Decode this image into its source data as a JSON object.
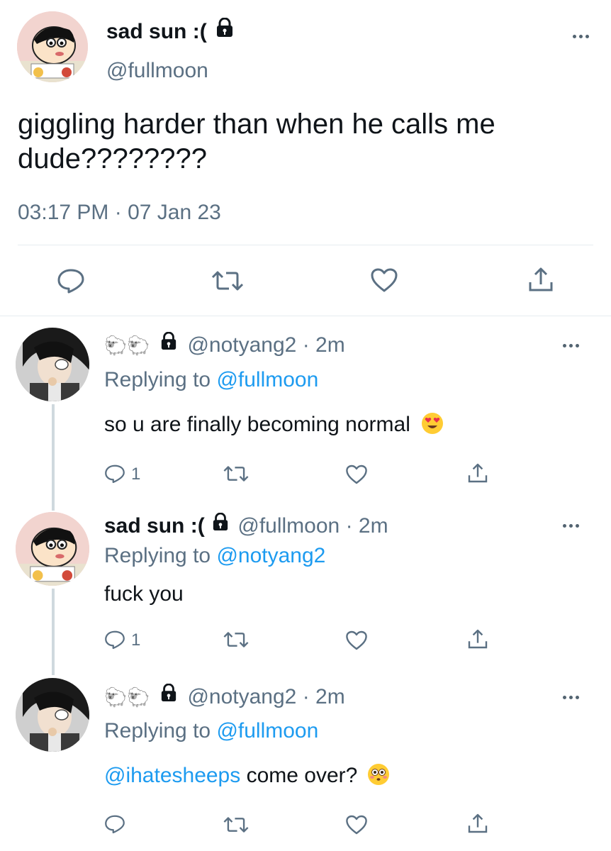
{
  "main_tweet": {
    "display_name": "sad sun :(",
    "handle": "@fullmoon",
    "text_line1": "giggling harder than when he calls me",
    "text_line2": "dude????????",
    "timestamp": "03:17 PM · 07 Jan 23"
  },
  "replies": [
    {
      "name_icons": "sheep-sheep-lock",
      "handle": "@notyang2",
      "time": "· 2m",
      "replying_label": "Replying to",
      "replying_to": "@fullmoon",
      "text": "so u are finally becoming normal",
      "emoji": "heart-eyes",
      "reply_count": "1"
    },
    {
      "display_name": "sad sun :(",
      "handle": "@fullmoon",
      "time": "· 2m",
      "replying_label": "Replying to",
      "replying_to": "@notyang2",
      "text": "fuck you",
      "reply_count": "1"
    },
    {
      "name_icons": "sheep-sheep-lock",
      "handle": "@notyang2",
      "time": "· 2m",
      "replying_label": "Replying to",
      "replying_to": "@fullmoon",
      "mention": "@ihatesheeps",
      "text": " come over?",
      "emoji": "flushed"
    }
  ],
  "colors": {
    "accent": "#1d9bf0",
    "muted": "#5b7083",
    "divider": "#e6ecf0",
    "thread_line": "#cfd9de"
  }
}
